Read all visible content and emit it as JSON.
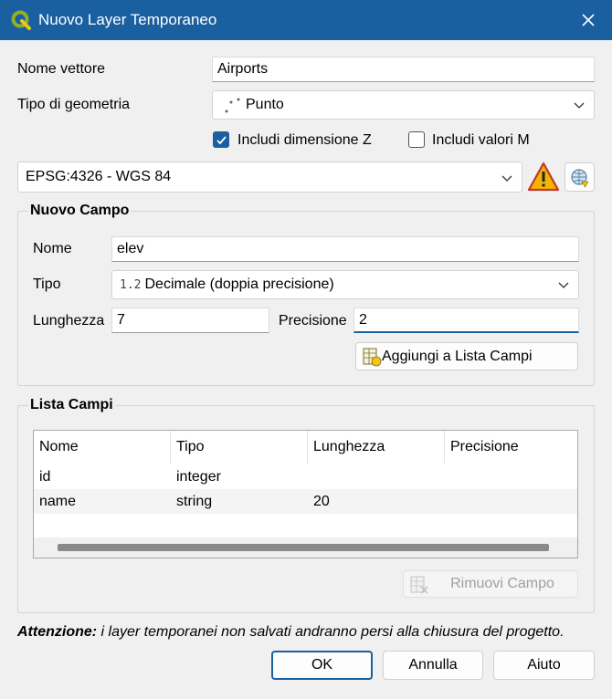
{
  "window": {
    "title": "Nuovo Layer Temporaneo"
  },
  "form": {
    "layer_name_label": "Nome vettore",
    "layer_name_value": "Airports",
    "geometry_label": "Tipo di geometria",
    "geometry_value": "Punto",
    "include_z_label": "Includi dimensione Z",
    "include_z_checked": true,
    "include_m_label": "Includi valori M",
    "include_m_checked": false,
    "crs_value": "EPSG:4326 - WGS 84"
  },
  "new_field": {
    "group_title": "Nuovo Campo",
    "name_label": "Nome",
    "name_value": "elev",
    "type_label": "Tipo",
    "type_icon_text": "1.2",
    "type_value": "Decimale (doppia precisione)",
    "length_label": "Lunghezza",
    "length_value": "7",
    "precision_label": "Precisione",
    "precision_value": "2",
    "add_button_label": "Aggiungi a Lista Campi"
  },
  "field_list": {
    "group_title": "Lista Campi",
    "columns": [
      "Nome",
      "Tipo",
      "Lunghezza",
      "Precisione"
    ],
    "rows": [
      [
        "id",
        "integer",
        "",
        ""
      ],
      [
        "name",
        "string",
        "20",
        ""
      ]
    ],
    "remove_button_label": "Rimuovi Campo"
  },
  "notice": {
    "bold": "Attenzione:",
    "text": " i layer temporanei non salvati andranno persi alla chiusura del progetto."
  },
  "buttons": {
    "ok": "OK",
    "cancel": "Annulla",
    "help": "Aiuto"
  },
  "colors": {
    "titlebar": "#1a5fa0",
    "accent": "#1a5fa0",
    "warning": "#f2b500"
  }
}
